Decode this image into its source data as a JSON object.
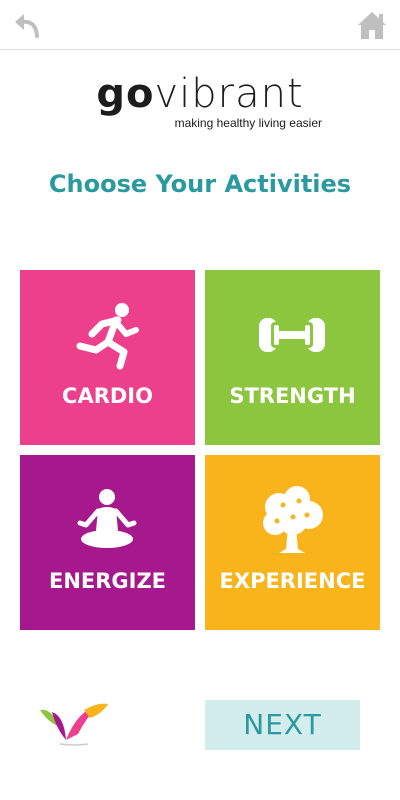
{
  "header": {
    "back_icon": "back-arrow-icon",
    "home_icon": "home-icon"
  },
  "brand": {
    "name_go": "go",
    "name_rest": "vibrant",
    "tagline": "making healthy living easier"
  },
  "heading": "Choose Your Activities",
  "activities": [
    {
      "label": "CARDIO",
      "icon": "running-person-icon",
      "color": "#ec3f8c"
    },
    {
      "label": "STRENGTH",
      "icon": "dumbbell-icon",
      "color": "#8cc63f"
    },
    {
      "label": "ENERGIZE",
      "icon": "meditation-icon",
      "color": "#a5198d"
    },
    {
      "label": "EXPERIENCE",
      "icon": "tree-icon",
      "color": "#f9b31b"
    }
  ],
  "footer": {
    "logo_icon": "govibrant-logo-mark",
    "next_label": "NEXT"
  },
  "colors": {
    "accent": "#2a9aa0",
    "next_bg": "#d3ecec",
    "header_icon": "#bfbfbf"
  }
}
